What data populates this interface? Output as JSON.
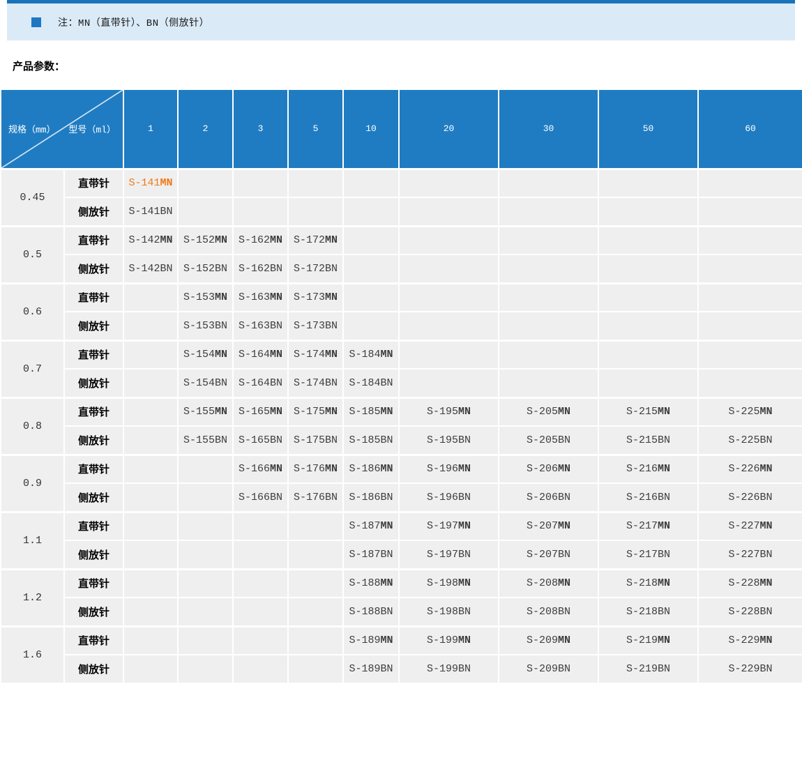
{
  "note": {
    "text": "注：MN（直带针）、BN（侧放针）"
  },
  "section_title": "产品参数：",
  "table": {
    "corner": {
      "left_label": "规格（mm）",
      "right_label": "型号（ml）"
    },
    "columns": [
      "1",
      "2",
      "3",
      "5",
      "10",
      "20",
      "30",
      "50",
      "60"
    ],
    "row_type_labels": {
      "mn": "直带针",
      "bn": "侧放针"
    },
    "groups": [
      {
        "spec": "0.45",
        "mn": [
          "S-141MN",
          "",
          "",
          "",
          "",
          "",
          "",
          "",
          ""
        ],
        "bn": [
          "S-141BN",
          "",
          "",
          "",
          "",
          "",
          "",
          "",
          ""
        ]
      },
      {
        "spec": "0.5",
        "mn": [
          "S-142MN",
          "S-152MN",
          "S-162MN",
          "S-172MN",
          "",
          "",
          "",
          "",
          ""
        ],
        "bn": [
          "S-142BN",
          "S-152BN",
          "S-162BN",
          "S-172BN",
          "",
          "",
          "",
          "",
          ""
        ]
      },
      {
        "spec": "0.6",
        "mn": [
          "",
          "S-153MN",
          "S-163MN",
          "S-173MN",
          "",
          "",
          "",
          "",
          ""
        ],
        "bn": [
          "",
          "S-153BN",
          "S-163BN",
          "S-173BN",
          "",
          "",
          "",
          "",
          ""
        ]
      },
      {
        "spec": "0.7",
        "mn": [
          "",
          "S-154MN",
          "S-164MN",
          "S-174MN",
          "S-184MN",
          "",
          "",
          "",
          ""
        ],
        "bn": [
          "",
          "S-154BN",
          "S-164BN",
          "S-174BN",
          "S-184BN",
          "",
          "",
          "",
          ""
        ]
      },
      {
        "spec": "0.8",
        "mn": [
          "",
          "S-155MN",
          "S-165MN",
          "S-175MN",
          "S-185MN",
          "S-195MN",
          "S-205MN",
          "S-215MN",
          "S-225MN"
        ],
        "bn": [
          "",
          "S-155BN",
          "S-165BN",
          "S-175BN",
          "S-185BN",
          "S-195BN",
          "S-205BN",
          "S-215BN",
          "S-225BN"
        ]
      },
      {
        "spec": "0.9",
        "mn": [
          "",
          "",
          "S-166MN",
          "S-176MN",
          "S-186MN",
          "S-196MN",
          "S-206MN",
          "S-216MN",
          "S-226MN"
        ],
        "bn": [
          "",
          "",
          "S-166BN",
          "S-176BN",
          "S-186BN",
          "S-196BN",
          "S-206BN",
          "S-216BN",
          "S-226BN"
        ]
      },
      {
        "spec": "1.1",
        "mn": [
          "",
          "",
          "",
          "",
          "S-187MN",
          "S-197MN",
          "S-207MN",
          "S-217MN",
          "S-227MN"
        ],
        "bn": [
          "",
          "",
          "",
          "",
          "S-187BN",
          "S-197BN",
          "S-207BN",
          "S-217BN",
          "S-227BN"
        ]
      },
      {
        "spec": "1.2",
        "mn": [
          "",
          "",
          "",
          "",
          "S-188MN",
          "S-198MN",
          "S-208MN",
          "S-218MN",
          "S-228MN"
        ],
        "bn": [
          "",
          "",
          "",
          "",
          "S-188BN",
          "S-198BN",
          "S-208BN",
          "S-218BN",
          "S-228BN"
        ]
      },
      {
        "spec": "1.6",
        "mn": [
          "",
          "",
          "",
          "",
          "S-189MN",
          "S-199MN",
          "S-209MN",
          "S-219MN",
          "S-229MN"
        ],
        "bn": [
          "",
          "",
          "",
          "",
          "S-189BN",
          "S-199BN",
          "S-209BN",
          "S-219BN",
          "S-229BN"
        ]
      }
    ],
    "highlight": {
      "group": 0,
      "row": "mn",
      "col": 0
    }
  },
  "colors": {
    "header_blue": "#1f7cc2",
    "top_bar_blue": "#1a72b9",
    "note_band_blue": "#daeaf7",
    "bullet_blue": "#1d78c4",
    "cell_background": "#efefef",
    "highlight_orange": "#f07818"
  }
}
